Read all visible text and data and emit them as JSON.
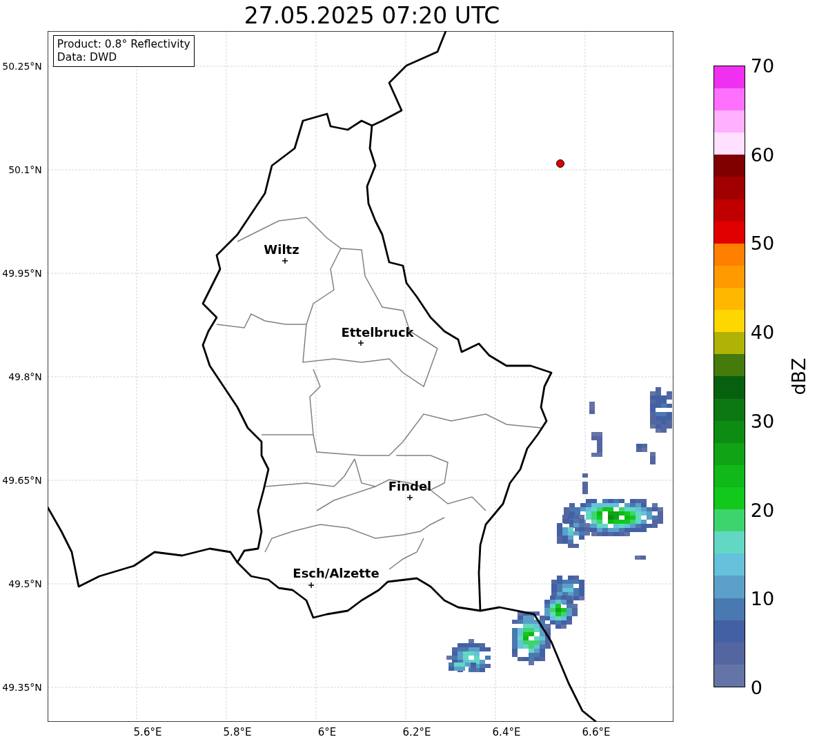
{
  "title": "27.05.2025 07:20 UTC",
  "info": [
    "Product: 0.8° Reflectivity",
    "Data: DWD"
  ],
  "lat_ticks": [
    "50.25°N",
    "50.1°N",
    "49.95°N",
    "49.8°N",
    "49.65°N",
    "49.5°N",
    "49.35°N"
  ],
  "lon_ticks": [
    "5.6°E",
    "5.8°E",
    "6°E",
    "6.2°E",
    "6.4°E",
    "6.6°E"
  ],
  "cities": [
    "Wiltz",
    "Ettelbruck",
    "Findel",
    "Esch/Alzette"
  ],
  "colorbar": {
    "label": "dBZ",
    "ticks": [
      "70",
      "60",
      "50",
      "40",
      "30",
      "20",
      "10",
      "0"
    ],
    "segments": [
      {
        "color": "#6474a6"
      },
      {
        "color": "#5366a0"
      },
      {
        "color": "#4360a5"
      },
      {
        "color": "#4a78b0"
      },
      {
        "color": "#5aa0c8"
      },
      {
        "color": "#66c1dc"
      },
      {
        "color": "#62d8c4"
      },
      {
        "color": "#3dd46e"
      },
      {
        "color": "#12c81a"
      },
      {
        "color": "#10b818"
      },
      {
        "color": "#0fa315"
      },
      {
        "color": "#0c8c12"
      },
      {
        "color": "#0b7812"
      },
      {
        "color": "#07600f"
      },
      {
        "color": "#457a0d"
      },
      {
        "color": "#aeb306"
      },
      {
        "color": "#ffd700"
      },
      {
        "color": "#ffb700"
      },
      {
        "color": "#ff9a00"
      },
      {
        "color": "#ff7f00"
      },
      {
        "color": "#e00000"
      },
      {
        "color": "#c00000"
      },
      {
        "color": "#a00000"
      },
      {
        "color": "#800000"
      },
      {
        "color": "#ffe0ff"
      },
      {
        "color": "#ffb0ff"
      },
      {
        "color": "#ff70ff"
      },
      {
        "color": "#f030f0"
      }
    ]
  }
}
